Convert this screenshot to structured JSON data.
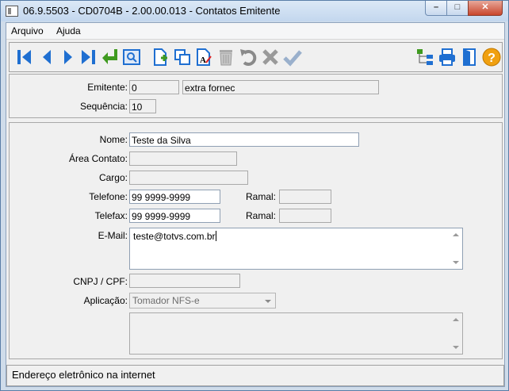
{
  "window": {
    "title": "06.9.5503 - CD0704B - 2.00.00.013 - Contatos Emitente",
    "controls": {
      "minimize": "–",
      "maximize": "□",
      "close": "✕"
    }
  },
  "menu": {
    "items": [
      "Arquivo",
      "Ajuda"
    ]
  },
  "toolbar": {
    "icons": [
      "first-record-icon",
      "previous-record-icon",
      "next-record-icon",
      "last-record-icon",
      "goto-enter-icon",
      "search-zoom-icon",
      "new-document-icon",
      "copy-icon",
      "edit-document-icon",
      "delete-trash-icon",
      "undo-icon",
      "cancel-x-icon",
      "confirm-check-icon",
      "tree-structure-icon",
      "print-icon",
      "exit-door-icon",
      "help-question-icon"
    ]
  },
  "header": {
    "emitente": {
      "label": "Emitente:",
      "code": "0",
      "name": "extra fornec"
    },
    "sequencia": {
      "label": "Sequência:",
      "value": "10"
    }
  },
  "form": {
    "nome": {
      "label": "Nome:",
      "value": "Teste da Silva"
    },
    "area_contato": {
      "label": "Área Contato:",
      "value": ""
    },
    "cargo": {
      "label": "Cargo:",
      "value": ""
    },
    "telefone": {
      "label": "Telefone:",
      "value": "99 9999-9999"
    },
    "telefone_ramal": {
      "label": "Ramal:",
      "value": ""
    },
    "telefax": {
      "label": "Telefax:",
      "value": "99 9999-9999"
    },
    "telefax_ramal": {
      "label": "Ramal:",
      "value": ""
    },
    "email": {
      "label": "E-Mail:",
      "value": "teste@totvs.com.br"
    },
    "cnpj_cpf": {
      "label": "CNPJ / CPF:",
      "value": ""
    },
    "aplicacao": {
      "label": "Aplicação:",
      "value": "Tomador NFS-e"
    }
  },
  "status": {
    "text": "Endereço eletrônico na internet"
  },
  "colors": {
    "accent_blue": "#1f6fd1",
    "check_blue": "#3a66b5",
    "green": "#3f9a1f",
    "help_orange": "#f0a010"
  }
}
